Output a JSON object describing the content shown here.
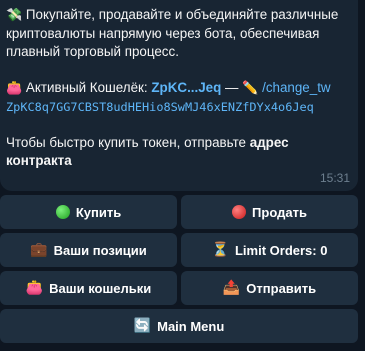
{
  "message": {
    "intro_icon": "money-with-wings",
    "intro": "Покупайте, продавайте и объединяйте различные криптовалюты напрямую через бота, обеспечивая плавный торговый процесс.",
    "wallet_label": "Активный Кошелёк:",
    "wallet_short": "ZpKC...Jeq",
    "dash": "—",
    "change_cmd": "/change_tw",
    "wallet_full": "ZpKC8q7GG7CBST8udHEHio8SwMJ46xENZfDYx4o6Jeq",
    "quick_buy_text": "Чтобы быстро купить токен, отправьте ",
    "quick_buy_bold": "адрес контракта",
    "time": "15:31"
  },
  "keyboard": {
    "buy": "Купить",
    "sell": "Продать",
    "positions": "Ваши позиции",
    "limit_orders": "Limit Orders: 0",
    "wallets": "Ваши кошельки",
    "send": "Отправить",
    "main_menu": "Main Menu"
  },
  "colors": {
    "background": "#0e1621",
    "bubble": "#182533",
    "button": "#1f2f3f",
    "link": "#5eb5f7",
    "buy": "#2ecc40",
    "sell": "#e0302a"
  }
}
